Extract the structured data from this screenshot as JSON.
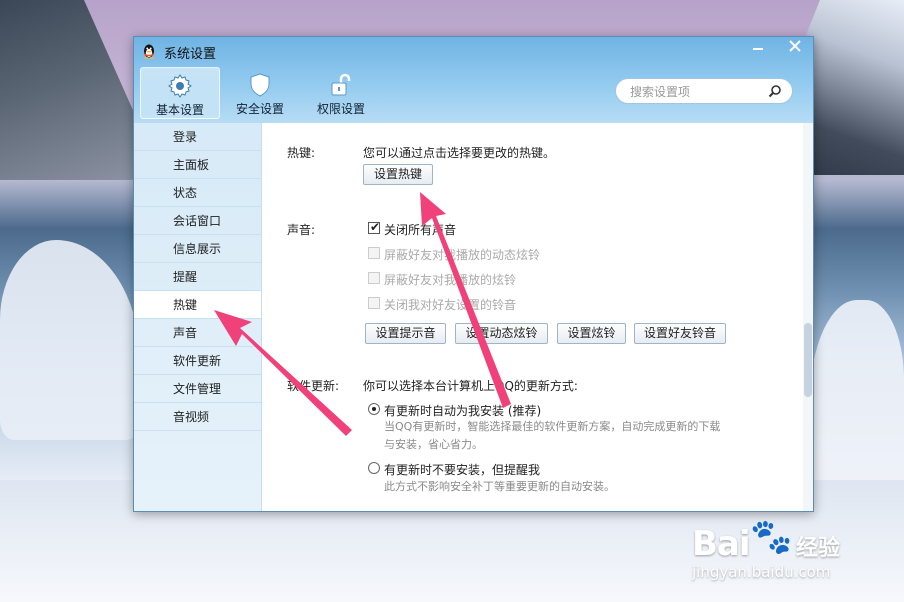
{
  "window": {
    "title": "系统设置"
  },
  "tabs": [
    {
      "label": "基本设置",
      "icon": "gear-icon"
    },
    {
      "label": "安全设置",
      "icon": "shield-icon"
    },
    {
      "label": "权限设置",
      "icon": "unlock-icon"
    }
  ],
  "search": {
    "placeholder": "搜索设置项"
  },
  "sidebar": {
    "items": [
      {
        "label": "登录"
      },
      {
        "label": "主面板"
      },
      {
        "label": "状态"
      },
      {
        "label": "会话窗口"
      },
      {
        "label": "信息展示"
      },
      {
        "label": "提醒"
      },
      {
        "label": "热键"
      },
      {
        "label": "声音"
      },
      {
        "label": "软件更新"
      },
      {
        "label": "文件管理"
      },
      {
        "label": "音视频"
      }
    ],
    "active": "热键"
  },
  "hotkey": {
    "section_label": "热键:",
    "description": "您可以通过点击选择要更改的热键。",
    "button": "设置热键"
  },
  "sound": {
    "section_label": "声音:",
    "options": [
      {
        "label": "关闭所有声音",
        "checked": true,
        "disabled": false
      },
      {
        "label": "屏蔽好友对我播放的动态炫铃",
        "checked": false,
        "disabled": true
      },
      {
        "label": "屏蔽好友对我播放的炫铃",
        "checked": false,
        "disabled": true
      },
      {
        "label": "关闭我对好友设置的铃音",
        "checked": false,
        "disabled": true
      }
    ],
    "buttons": [
      "设置提示音",
      "设置动态炫铃",
      "设置炫铃",
      "设置好友铃音"
    ]
  },
  "update": {
    "section_label": "软件更新:",
    "description": "你可以选择本台计算机上QQ的更新方式:",
    "options": [
      {
        "label": "有更新时自动为我安装 (推荐)",
        "selected": true,
        "desc_lines": [
          "当QQ有更新时，智能选择最佳的软件更新方案，自动完成更新的下载",
          "与安装，省心省力。"
        ]
      },
      {
        "label": "有更新时不要安装，但提醒我",
        "selected": false,
        "desc_lines": [
          "此方式不影响安全补丁等重要更新的自动安装。"
        ]
      }
    ]
  },
  "watermark": {
    "brand": "Bai",
    "paw": "🐾",
    "sub": "经验",
    "url": "jingyan.baidu.com"
  },
  "colors": {
    "arrow": "#f0417a",
    "titlebar": "#6fb3e4"
  }
}
